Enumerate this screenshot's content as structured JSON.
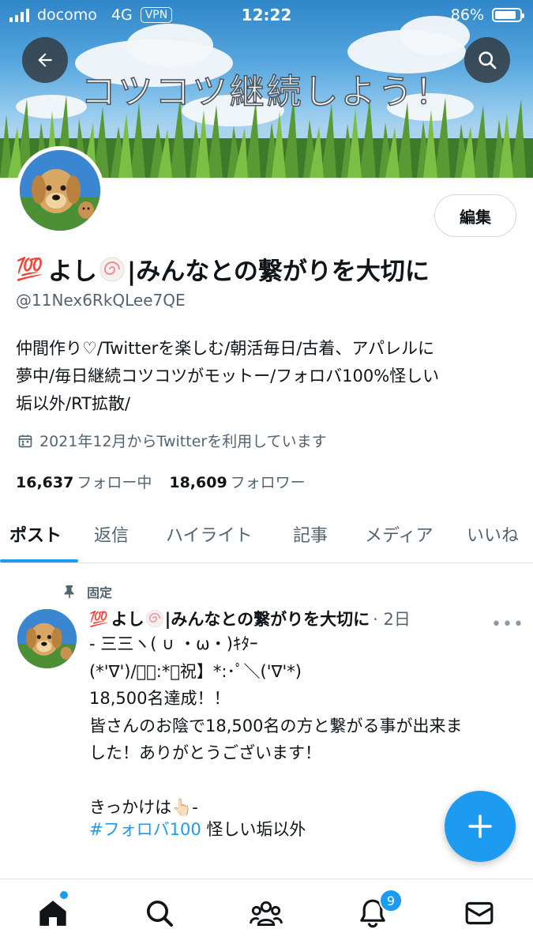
{
  "status_bar": {
    "carrier": "docomo",
    "network": "4G",
    "vpn": "VPN",
    "time": "12:22",
    "battery": "86%",
    "battery_level": 0.86
  },
  "banner": {
    "title": "コツコツ継続しよう！"
  },
  "profile": {
    "edit_label": "編集",
    "name_prefix_emoji": "💯",
    "name_part1": "よし",
    "name_part2": "|みんなとの繋がりを大切に",
    "handle": "@11Nex6RkQLee7QE",
    "bio": "仲間作り♡/Twitterを楽しむ/朝活毎日/古着、アパレルに\n夢中/毎日継続コツコツがモットー/フォロバ100%怪しい\n垢以外/RT拡散/",
    "joined": "2021年12月からTwitterを利用しています",
    "following_count": "16,637",
    "following_label": "フォロー中",
    "followers_count": "18,609",
    "followers_label": "フォロワー"
  },
  "tabs": [
    "ポスト",
    "返信",
    "ハイライト",
    "記事",
    "メディア",
    "いいね"
  ],
  "tweet": {
    "pinned_label": "固定",
    "name_prefix_emoji": "💯",
    "name_part1": "よし",
    "name_part2": "|みんなとの繋がりを大切に",
    "date": "· 2日",
    "more": "•••",
    "body": "- 三三ヽ( ∪ ・ω・)ｷﾀｰ\n(*'∇')/ﾟ･:*【祝】*:･ﾟ＼('∇'*)\n18,500名達成！！\n皆さんのお陰で18,500名の方と繋がる事が出来ま\nした！ありがとうございます！\n\nきっかけは👆🏻-",
    "hashtag": "#フォロバ100",
    "tag_rest": " 怪しい垢以外"
  },
  "bottom_nav": {
    "notifications_badge": "9"
  },
  "colors": {
    "accent": "#1d9bf0",
    "text": "#0f1419",
    "muted": "#536471"
  },
  "icons": [
    "back-arrow-icon",
    "search-icon",
    "calendar-icon",
    "pin-icon",
    "plus-icon",
    "home-icon",
    "communities-icon",
    "bell-icon",
    "mail-icon"
  ]
}
